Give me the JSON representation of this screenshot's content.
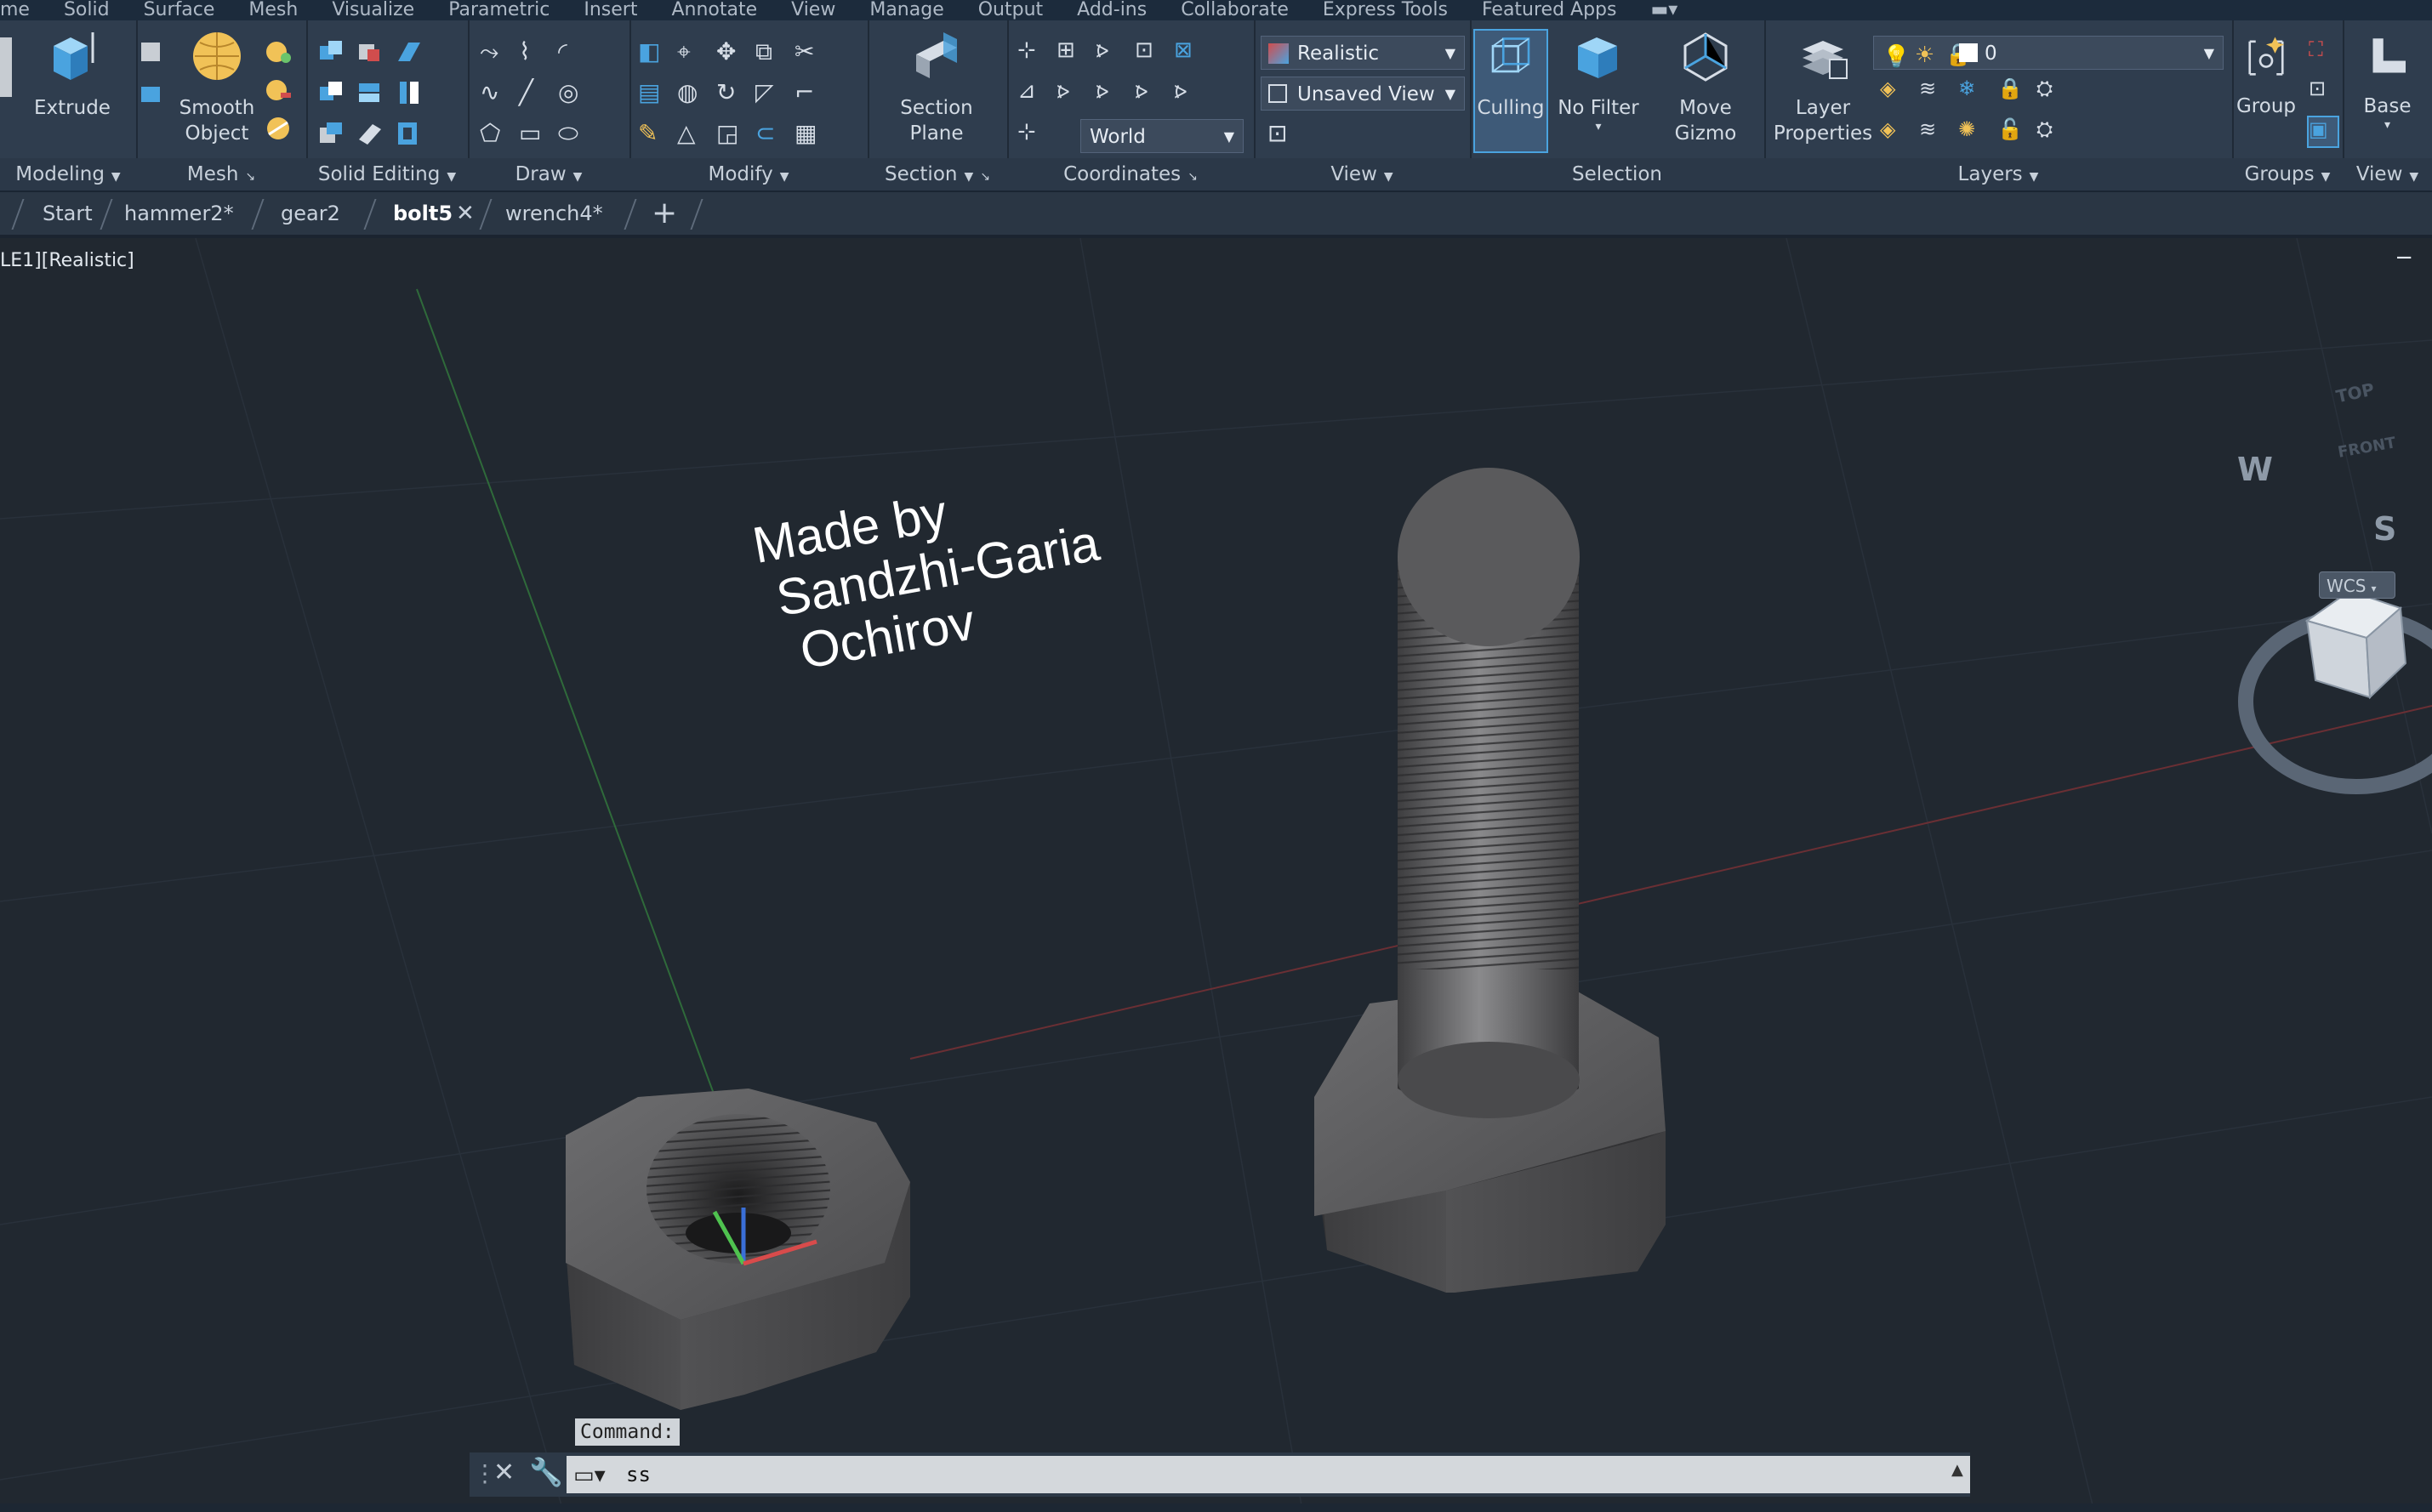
{
  "menu": [
    "me",
    "Solid",
    "Surface",
    "Mesh",
    "Visualize",
    "Parametric",
    "Insert",
    "Annotate",
    "View",
    "Manage",
    "Output",
    "Add-ins",
    "Collaborate",
    "Express Tools",
    "Featured Apps"
  ],
  "panels": {
    "modeling": {
      "title": "Modeling",
      "extrude": "Extrude"
    },
    "mesh": {
      "title": "Mesh",
      "smooth": "Smooth\nObject"
    },
    "solid_editing": {
      "title": "Solid Editing"
    },
    "draw": {
      "title": "Draw"
    },
    "modify": {
      "title": "Modify"
    },
    "section": {
      "title": "Section",
      "plane": "Section\nPlane"
    },
    "coordinates": {
      "title": "Coordinates",
      "world": "World"
    },
    "view": {
      "title": "View",
      "visual_style": "Realistic",
      "saved_view": "Unsaved View"
    },
    "selection": {
      "title": "Selection",
      "culling": "Culling",
      "no_filter": "No Filter",
      "move_gizmo": "Move\nGizmo"
    },
    "layers": {
      "title": "Layers",
      "layer_properties": "Layer\nProperties",
      "current_layer": "0"
    },
    "groups": {
      "title": "Groups",
      "group": "Group"
    },
    "view2": {
      "title": "View",
      "base": "Base"
    }
  },
  "tabs": [
    {
      "label": "Start"
    },
    {
      "label": "hammer2*"
    },
    {
      "label": "gear2"
    },
    {
      "label": "bolt5",
      "active": true
    },
    {
      "label": "wrench4*"
    }
  ],
  "viewport": {
    "label": "LE1][Realistic]",
    "watermark": "Made by\n Sandzhi-Garia\n  Ochirov",
    "viewcube": {
      "top": "TOP",
      "front": "FRONT",
      "west": "W",
      "south": "S",
      "wcs": "WCS"
    }
  },
  "command": {
    "label": "Command:",
    "value": "ss"
  },
  "colors": {
    "ribbon": "#2f3d4e",
    "viewport": "#212830",
    "accent": "#4aa3df"
  }
}
